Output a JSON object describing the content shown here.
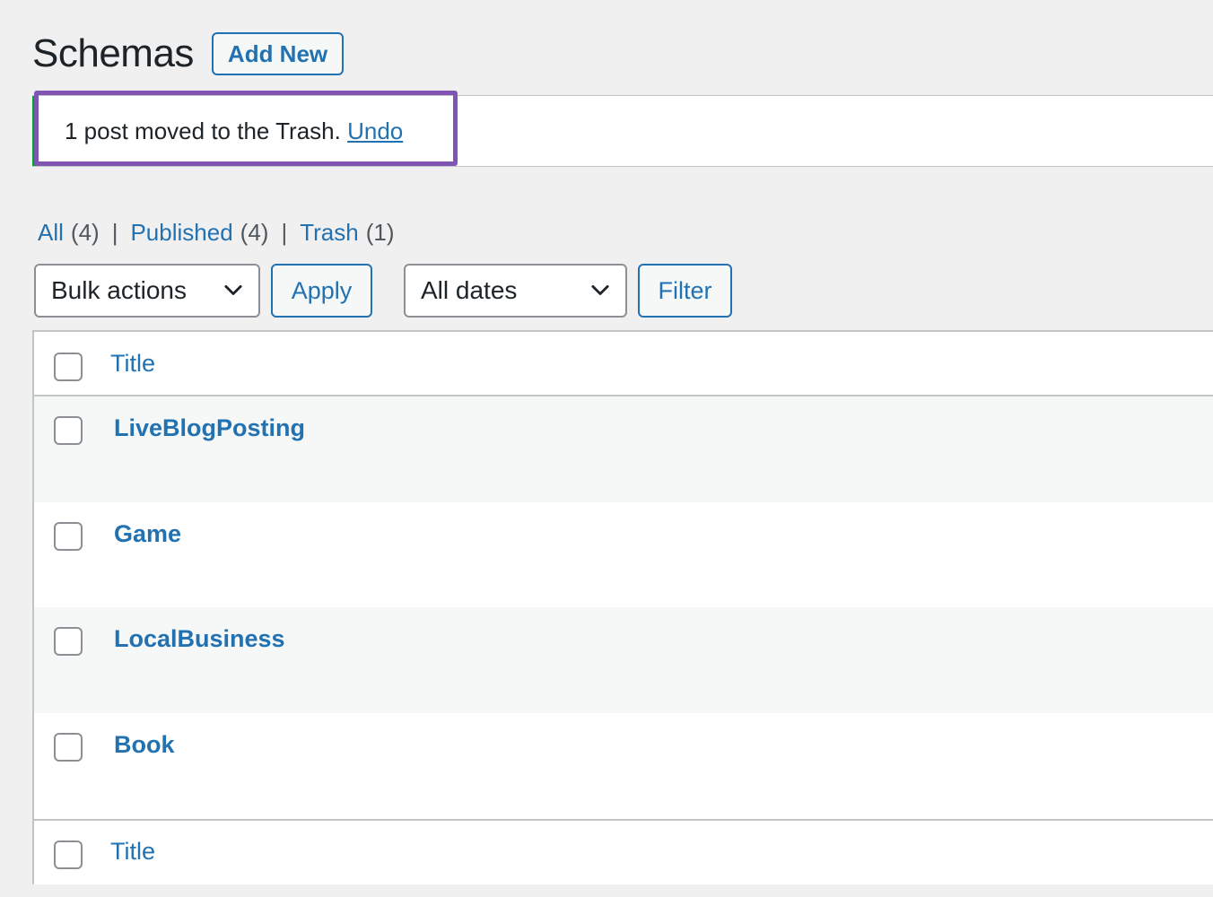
{
  "header": {
    "title": "Schemas",
    "add_new_label": "Add New"
  },
  "notice": {
    "message": "1 post moved to the Trash.",
    "undo_label": "Undo"
  },
  "views": [
    {
      "label": "All",
      "count": "(4)"
    },
    {
      "label": "Published",
      "count": "(4)"
    },
    {
      "label": "Trash",
      "count": "(1)"
    }
  ],
  "view_separator": "|",
  "bulk_actions": {
    "selected": "Bulk actions",
    "apply_label": "Apply"
  },
  "date_filter": {
    "selected": "All dates",
    "filter_label": "Filter"
  },
  "table": {
    "column_title": "Title",
    "rows": [
      {
        "title": "LiveBlogPosting"
      },
      {
        "title": "Game"
      },
      {
        "title": "LocalBusiness"
      },
      {
        "title": "Book"
      }
    ]
  },
  "colors": {
    "link": "#2271b1",
    "highlight": "#7f54b3",
    "notice_accent": "#00a32a"
  },
  "icons": {
    "dropdown": "chevron-down-icon"
  }
}
